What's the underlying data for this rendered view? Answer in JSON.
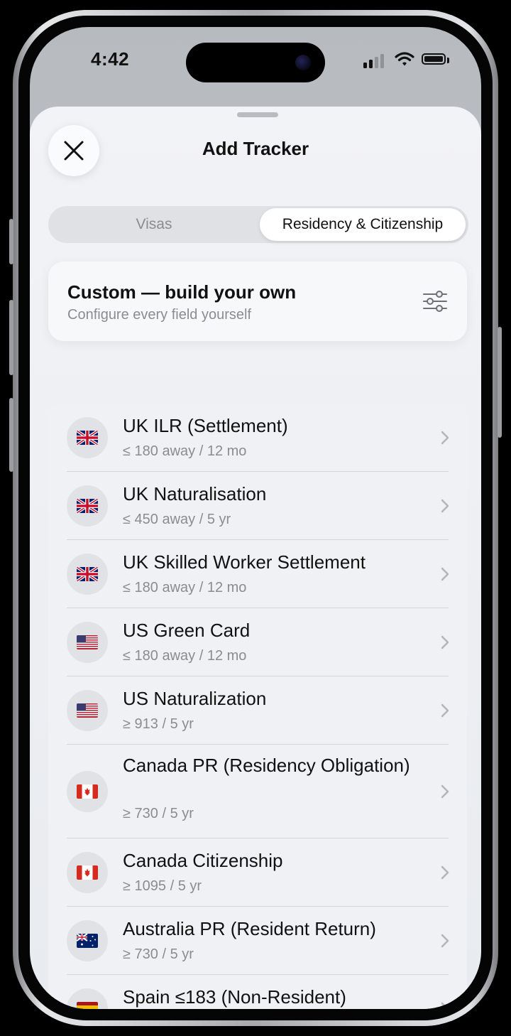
{
  "status_bar": {
    "time": "4:42"
  },
  "sheet": {
    "title": "Add Tracker",
    "close_icon": "close-icon"
  },
  "segments": {
    "tabs": [
      {
        "label": "Visas",
        "selected": false
      },
      {
        "label": "Residency & Citizenship",
        "selected": true
      }
    ]
  },
  "custom": {
    "title": "Custom — build your own",
    "subtitle": "Configure every field yourself",
    "icon": "sliders-icon"
  },
  "trackers": [
    {
      "title": "UK ILR (Settlement)",
      "subtitle": "≤ 180 away / 12 mo",
      "flag": "uk"
    },
    {
      "title": "UK Naturalisation",
      "subtitle": "≤ 450 away / 5 yr",
      "flag": "uk"
    },
    {
      "title": "UK Skilled Worker Settlement",
      "subtitle": "≤ 180 away / 12 mo",
      "flag": "uk"
    },
    {
      "title": "US Green Card",
      "subtitle": "≤ 180 away / 12 mo",
      "flag": "us"
    },
    {
      "title": "US Naturalization",
      "subtitle": "≥ 913 / 5 yr",
      "flag": "us"
    },
    {
      "title": "Canada PR (Residency Obligation)",
      "subtitle": "≥ 730 / 5 yr",
      "flag": "ca"
    },
    {
      "title": "Canada Citizenship",
      "subtitle": "≥ 1095 / 5 yr",
      "flag": "ca"
    },
    {
      "title": "Australia PR (Resident Return)",
      "subtitle": "≥ 730 / 5 yr",
      "flag": "au"
    },
    {
      "title": "Spain ≤183 (Non-Resident)",
      "subtitle": "",
      "flag": "es"
    }
  ],
  "colors": {
    "text_primary": "#111111",
    "text_secondary": "#8a8c91",
    "sheet_bg": "#f2f3f6"
  }
}
